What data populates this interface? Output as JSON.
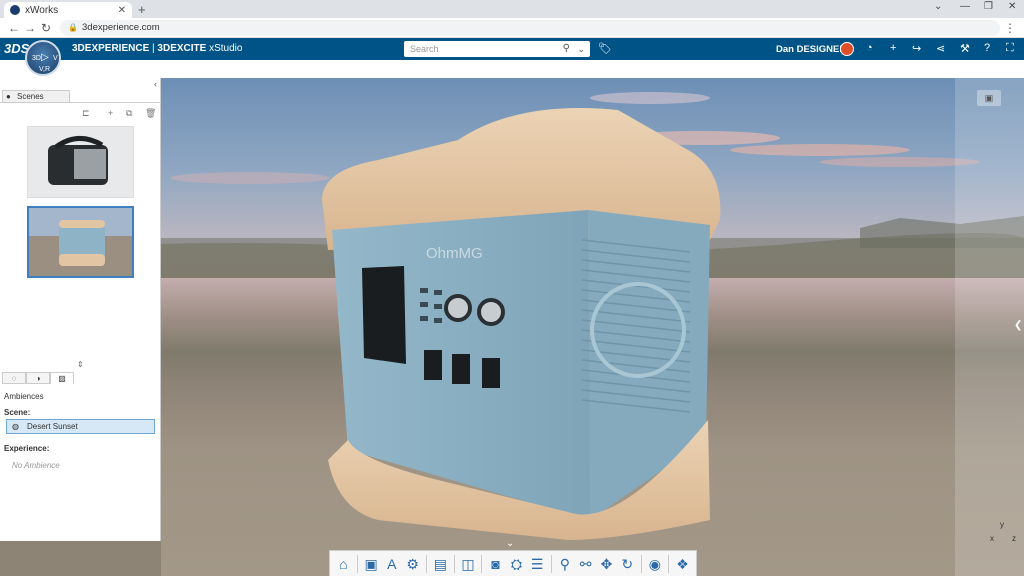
{
  "browser": {
    "tab_title": "xWorks",
    "url": "3dexperience.com"
  },
  "topbar": {
    "brand_main": "3DEXPERIENCE",
    "brand_sep": " | ",
    "brand_app": "3DEXCITE",
    "brand_sub": " xStudio",
    "search_placeholder": "Search",
    "username": "Dan DESIGNER"
  },
  "compass": {
    "label_3d": "3D",
    "label_v": "V",
    "label_vr": "V,R"
  },
  "left_panel": {
    "tab_label": "Scenes",
    "section_label": "Ambiences",
    "scene_label": "Scene:",
    "scene_value": "Desert Sunset",
    "experience_label": "Experience:",
    "experience_value": "No Ambience"
  },
  "model": {
    "brand_text": "OhmMG"
  },
  "viewport": {
    "axis_y": "y",
    "axis_x": "x",
    "axis_z": "z"
  },
  "icons": {
    "toolbar": [
      "home-icon",
      "save-icon",
      "text-style-icon",
      "settings-icon",
      "image-icon",
      "book-icon",
      "render-icon",
      "camera-view-icon",
      "list-icon",
      "zoom-icon",
      "zoom-fit-icon",
      "pan-icon",
      "rotate-icon",
      "snapshot-icon",
      "gallery-icon"
    ]
  },
  "colors": {
    "topbar": "#005386",
    "accent": "#3d7fbf",
    "model_blue": "#8fb3c6",
    "model_sand": "#e2c5a3"
  }
}
